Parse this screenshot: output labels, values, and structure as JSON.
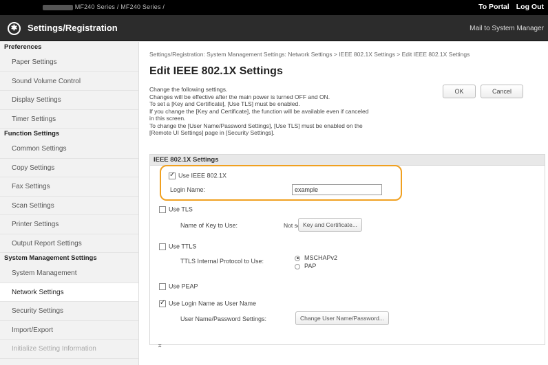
{
  "topbar": {
    "device_path": "MF240 Series / MF240 Series /",
    "portal_link": "To Portal",
    "logout_link": "Log Out"
  },
  "header": {
    "app_title": "Settings/Registration",
    "mail_link": "Mail to System Manager"
  },
  "sidebar": {
    "groups": [
      {
        "heading": "Preferences",
        "items": [
          "Paper Settings",
          "Sound Volume Control",
          "Display Settings",
          "Timer Settings"
        ]
      },
      {
        "heading": "Function Settings",
        "items": [
          "Common Settings",
          "Copy Settings",
          "Fax Settings",
          "Scan Settings",
          "Printer Settings",
          "Output Report Settings"
        ]
      },
      {
        "heading": "System Management Settings",
        "items": [
          "System Management",
          "Network Settings",
          "Security Settings",
          "Import/Export",
          "Initialize Setting Information"
        ]
      }
    ],
    "active_item": "Network Settings"
  },
  "main": {
    "breadcrumb": "Settings/Registration: System Management Settings: Network Settings > IEEE 802.1X Settings > Edit IEEE 802.1X Settings",
    "title": "Edit IEEE 802.1X Settings",
    "description": [
      "Change the following settings.",
      "Changes will be effective after the main power is turned OFF and ON.",
      "To set a [Key and Certificate], [Use TLS] must be enabled.",
      "If you change the [Key and Certificate], the function will be available even if canceled",
      "in this screen.",
      "To change the [User Name/Password Settings], [Use TLS] must be enabled on the",
      "[Remote UI Settings] page in [Security Settings]."
    ],
    "ok_label": "OK",
    "cancel_label": "Cancel"
  },
  "section": {
    "heading": "IEEE 802.1X Settings",
    "use_ieee_label": "Use IEEE 802.1X",
    "use_ieee_checked": true,
    "login_name_label": "Login Name:",
    "login_name_value": "example",
    "use_tls_label": "Use TLS",
    "use_tls_checked": false,
    "key_name_label": "Name of Key to Use:",
    "key_name_value": "Not set.",
    "key_cert_button": "Key and Certificate...",
    "use_ttls_label": "Use TTLS",
    "use_ttls_checked": false,
    "ttls_protocol_label": "TTLS Internal Protocol to Use:",
    "ttls_options": [
      "MSCHAPv2",
      "PAP"
    ],
    "ttls_selected": "MSCHAPv2",
    "use_peap_label": "Use PEAP",
    "use_peap_checked": false,
    "use_login_as_user_label": "Use Login Name as User Name",
    "use_login_as_user_checked": true,
    "user_pw_label": "User Name/Password Settings:",
    "change_user_pw_button": "Change User Name/Password...",
    "highlight_color": "#f0a020"
  },
  "footer": {
    "top_icon_glyph": "⌅"
  }
}
